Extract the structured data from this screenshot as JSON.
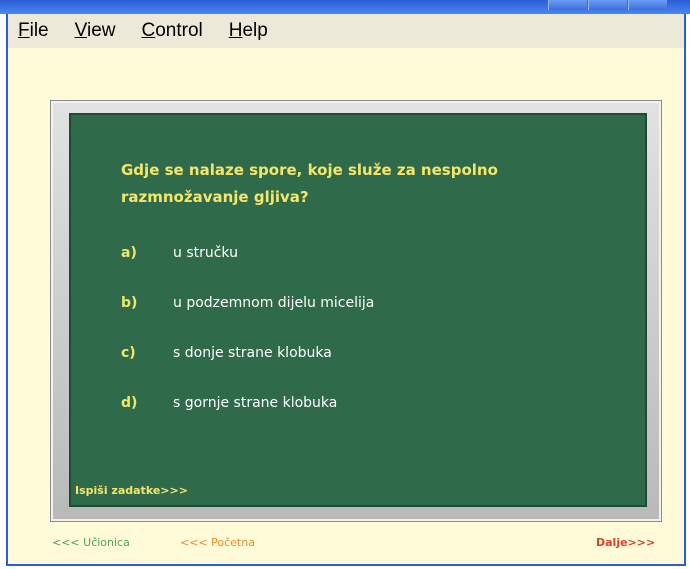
{
  "menu": {
    "items": [
      {
        "accel": "F",
        "rest": "ile"
      },
      {
        "accel": "V",
        "rest": "iew"
      },
      {
        "accel": "C",
        "rest": "ontrol"
      },
      {
        "accel": "H",
        "rest": "elp"
      }
    ]
  },
  "quiz": {
    "question_line1": "Gdje se nalaze spore, koje služe za nespolno",
    "question_line2": "razmnožavanje gljiva?",
    "answers": [
      {
        "letter": "a)",
        "text": "u stručku"
      },
      {
        "letter": "b)",
        "text": "u podzemnom dijelu micelija"
      },
      {
        "letter": "c)",
        "text": "s donje strane klobuka"
      },
      {
        "letter": "d)",
        "text": "s gornje strane klobuka"
      }
    ],
    "print_tasks_label": "Ispiši zadatke>>>"
  },
  "nav": {
    "classroom_label": "<<< Učionica",
    "home_label": "<<< Početna",
    "next_label": "Dalje>>>"
  },
  "colors": {
    "board": "#2f6b4b",
    "question_text": "#f5e66a",
    "answer_text": "#ffffff",
    "classroom_link": "#4aa84a",
    "home_link": "#e88a2a",
    "next_link": "#d8402a",
    "stage_background": "#fffbd9"
  }
}
